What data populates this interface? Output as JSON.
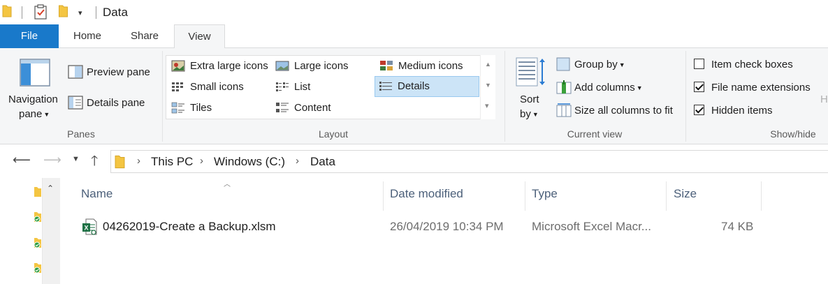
{
  "window": {
    "title": "Data"
  },
  "tabs": {
    "file": "File",
    "home": "Home",
    "share": "Share",
    "view": "View"
  },
  "panes": {
    "navigation_pane_line1": "Navigation",
    "navigation_pane_line2": "pane",
    "preview_pane": "Preview pane",
    "details_pane": "Details pane",
    "group_label": "Panes"
  },
  "layout": {
    "items": {
      "extra_large": "Extra large icons",
      "large": "Large icons",
      "medium": "Medium icons",
      "small": "Small icons",
      "list": "List",
      "details": "Details",
      "tiles": "Tiles",
      "content": "Content"
    },
    "selected": "Details",
    "group_label": "Layout"
  },
  "current_view": {
    "sort_by_line1": "Sort",
    "sort_by_line2": "by",
    "group_by": "Group by",
    "add_columns": "Add columns",
    "size_all_columns": "Size all columns to fit",
    "group_label": "Current view"
  },
  "show_hide": {
    "item_check_boxes": {
      "label": "Item check boxes",
      "checked": false
    },
    "file_name_extensions": {
      "label": "File name extensions",
      "checked": true
    },
    "hidden_items": {
      "label": "Hidden items",
      "checked": true
    },
    "group_label": "Show/hide",
    "overflow_letter": "H"
  },
  "address": {
    "crumbs": [
      "This PC",
      "Windows (C:)",
      "Data"
    ]
  },
  "columns": {
    "name": "Name",
    "date": "Date modified",
    "type": "Type",
    "size": "Size"
  },
  "files": [
    {
      "name": "04262019-Create a Backup.xlsm",
      "date": "26/04/2019 10:34 PM",
      "type": "Microsoft Excel Macr...",
      "size": "74 KB"
    }
  ],
  "colors": {
    "accent": "#1979ca",
    "folder": "#f4c542",
    "selected": "#cce4f7",
    "excel": "#1e7145",
    "sync_ok": "#2e9e3e"
  }
}
